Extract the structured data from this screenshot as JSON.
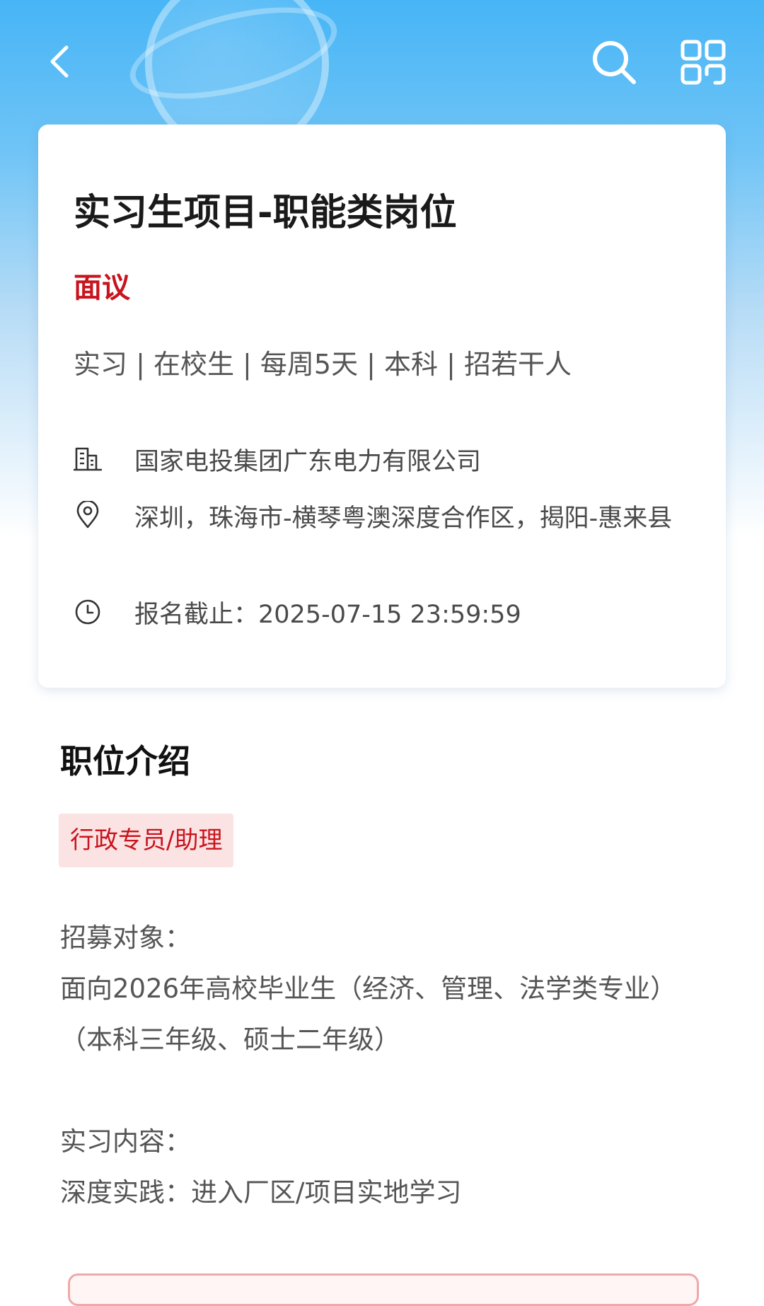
{
  "job": {
    "title": "实习生项目-职能类岗位",
    "salary": "面议",
    "tags": "实习 | 在校生 | 每周5天 | 本科 | 招若干人",
    "company": "国家电投集团广东电力有限公司",
    "location": "深圳，珠海市-横琴粤澳深度合作区，揭阳-惠来县",
    "deadline": "报名截止：2025-07-15 23:59:59"
  },
  "intro": {
    "section_title": "职位介绍",
    "category_tag": "行政专员/助理",
    "recruit_label": "招募对象：",
    "recruit_line1": "面向2026年高校毕业生（经济、管理、法学类专业）",
    "recruit_line2": "（本科三年级、硕士二年级）",
    "content_label": "实习内容：",
    "content_line1": "深度实践：进入厂区/项目实地学习"
  },
  "icons": {
    "back": "chevron-left-icon",
    "search": "search-icon",
    "apps": "grid-icon",
    "company": "building-icon",
    "location": "location-pin-icon",
    "deadline": "clock-icon"
  },
  "colors": {
    "accent_red": "#c8141e",
    "tag_bg": "#fbe3e3",
    "header_blue": "#47b5f6"
  }
}
